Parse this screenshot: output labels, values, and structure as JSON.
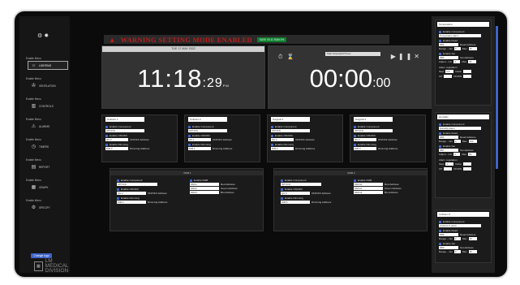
{
  "warning": {
    "text": "WARNING SETTING MODE ENABLED",
    "badge": "SAVE 00:11 RAM 0%",
    "color": "#c01e1e"
  },
  "sidebar": {
    "items": [
      {
        "caption": "Enable Menu",
        "label": "LIGHTING",
        "icon": "gear-icon",
        "active": true
      },
      {
        "caption": "Enable Menu",
        "label": "VENTILATION",
        "icon": "fan-icon",
        "active": false
      },
      {
        "caption": "Enable Menu",
        "label": "CONTROLS",
        "icon": "sliders-icon",
        "active": false
      },
      {
        "caption": "Enable Menu",
        "label": "ALARMS",
        "icon": "alarm-icon",
        "active": false
      },
      {
        "caption": "Enable Menu",
        "label": "TIMERS",
        "icon": "timer-icon",
        "active": false
      },
      {
        "caption": "Enable Menu",
        "label": "REPORT",
        "icon": "report-icon",
        "active": false
      },
      {
        "caption": "Enable Menu",
        "label": "GRAPH",
        "icon": "graph-icon",
        "active": false
      },
      {
        "caption": "Enable Menu",
        "label": "SPECIFY",
        "icon": "settings-icon",
        "active": false
      }
    ],
    "change_logo": "Change logo",
    "logo_line1": "LM MEDICAL",
    "logo_line2": "DIVISION"
  },
  "clock": {
    "date": "TUE 17 MAY 2022",
    "hm": "11:18",
    "sec": ":29",
    "ampm": "PM"
  },
  "timer": {
    "select": "Start Stopwatch/Timer",
    "hm": "00:00",
    "sec": ":00"
  },
  "lights": [
    {
      "name": "Ambient 1",
      "c1": "Enable Component",
      "v1": "OPTION",
      "c2": "Enable ON/OFF",
      "v2": "QS 0",
      "a2": "ON/OFF Address",
      "c3": "Enable Dimming",
      "v3": "DIM 0",
      "a3": "Dimming Address"
    },
    {
      "name": "Ambient 2",
      "c1": "Enable Component",
      "v1": "OPTION",
      "c2": "Enable ON/OFF",
      "v2": "QS 1",
      "a2": "ON/OFF Address",
      "c3": "Enable Dimming",
      "v3": "DIM 1",
      "a3": "Dimming Address"
    },
    {
      "name": "Surgical 1",
      "c1": "Enable Component",
      "v1": "OPTION",
      "c2": "Enable ON/OFF",
      "v2": "QS 2",
      "a2": "ON/OFF Address",
      "c3": "Enable Dimming",
      "v3": "DIM 2",
      "a3": "Dimming Address"
    },
    {
      "name": "Surgical 2",
      "c1": "Enable Component",
      "v1": "OPTION",
      "c2": "Enable ON/OFF",
      "v2": "QS 3",
      "a2": "ON/OFF Address",
      "c3": "Enable Dimming",
      "v3": "DIM 3",
      "a3": "Dimming Address"
    }
  ],
  "rgb": [
    {
      "name": "RGB 1",
      "c1": "Enable Component",
      "v1": "OPTION",
      "c2": "Enable ON/OFF",
      "v2": "QS 4",
      "a2": "ON/OFF Address",
      "c3": "Enable Dimming",
      "v3": "DIM 4",
      "a3": "Dimming Address",
      "rgb_label": "Enable RGB",
      "r": "DMX1",
      "g": "DMX2",
      "b": "DMX3",
      "r_lbl": "Red Address",
      "g_lbl": "Green Address",
      "b_lbl": "Blu Address"
    },
    {
      "name": "RGB 2",
      "c1": "Enable Component",
      "v1": "OPTION",
      "c2": "Enable ON/OFF",
      "v2": "QS 5",
      "a2": "ON/OFF Address",
      "c3": "Enable Dimming",
      "v3": "DIM 5",
      "a3": "Dimming Address",
      "rgb_label": "Enable RGB",
      "r": "DMX10",
      "g": "DMX11",
      "b": "DMX12",
      "r_lbl": "Red Address",
      "g_lbl": "Green Address",
      "b_lbl": "Blu Address"
    }
  ],
  "right": [
    {
      "title": "Temperature",
      "comp": "Enable Component",
      "comp_v": "Temperature alarm",
      "read": "Enable Read",
      "read_v": "DB4",
      "read_a": "Read Address",
      "range": "Range - min",
      "min": "0",
      "max_l": "Max",
      "max": "50",
      "set": "Enable Set",
      "set_v": "DB5",
      "set_a": "Set Address",
      "adj": "Adjust - min",
      "amin": "0",
      "amax": "30",
      "alarm": "Alarm regulation",
      "step": "Step",
      "step_v": "0.5",
      "delta": "Delta",
      "up": "UP",
      "down": "DOWN"
    },
    {
      "title": "Humidity",
      "comp": "Enable Component",
      "comp_v": "Humidity alarm",
      "read": "Enable Read",
      "read_v": "DB6",
      "read_a": "Read Address",
      "range": "Range - min",
      "min": "0",
      "max_l": "Max",
      "max": "100",
      "set": "Enable Set",
      "set_v": "DB7",
      "set_a": "Set Address",
      "adj": "Adjust - min",
      "amin": "0",
      "amax": "80",
      "alarm": "Alarm regulation",
      "step": "Step",
      "step_v": "1",
      "delta": "Delta",
      "up": "UP",
      "down": "DOWN"
    },
    {
      "title": "Ambient P.",
      "comp": "Enable Component",
      "comp_v": "Ambient P. alarm",
      "read": "Enable Read",
      "read_v": "DB8",
      "read_a": "Read Address",
      "range": "Range - min",
      "min": "0",
      "max_l": "Max",
      "max": "50",
      "set": "Enable Set",
      "set_v": "DB9",
      "set_a": "Set Address",
      "adj": "Range - min",
      "amin": "0",
      "amax": "50"
    }
  ]
}
